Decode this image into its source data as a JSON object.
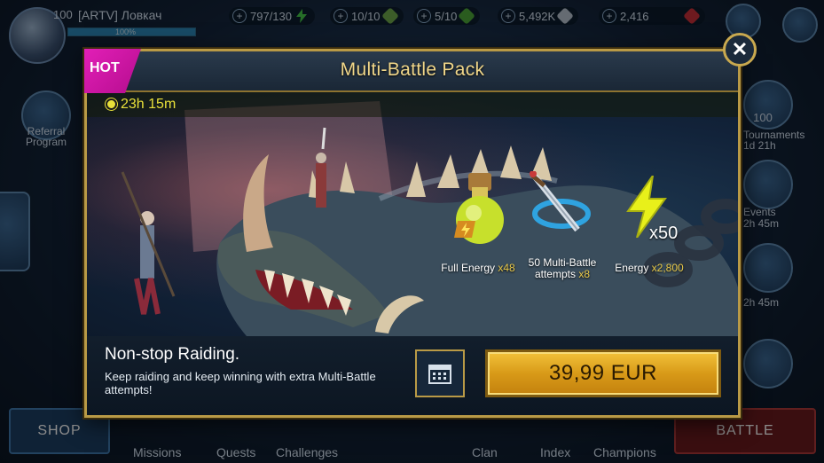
{
  "hud": {
    "player_level": "100",
    "player_name": "[ARTV] Ловкач",
    "xp_percent_text": "100%",
    "resources": [
      {
        "value": "797/130",
        "icon": "energy-icon",
        "color": "#45c94a"
      },
      {
        "value": "10/10",
        "icon": "arena-token-icon",
        "color": "#6ea84b"
      },
      {
        "value": "5/10",
        "icon": "clan-boss-key-icon",
        "color": "#4da83a"
      },
      {
        "value": "5,492K",
        "icon": "silver-icon",
        "color": "#b8c4cf"
      },
      {
        "value": "2,416",
        "icon": "ruby-icon",
        "color": "#c9303a"
      }
    ],
    "left_menu": {
      "referral_label": "Referral Program"
    },
    "right_menu": {
      "tournaments_count": "100",
      "tournaments_label": "Tournaments",
      "tournaments_timer": "1d 21h",
      "events_label": "Events",
      "events_timer": "2h 45m",
      "other_timer": "2h 45m"
    },
    "bottom_nav": {
      "shop": "SHOP",
      "missions": "Missions",
      "quests": "Quests",
      "challenges": "Challenges",
      "clan": "Clan",
      "index": "Index",
      "champions": "Champions",
      "battle": "BATTLE"
    }
  },
  "offer": {
    "badge": "HOT",
    "title": "Multi-Battle Pack",
    "timer": "23h 15m",
    "rewards": [
      {
        "label": "Full Energy",
        "mult": "x48",
        "icon": "energy-potion-icon"
      },
      {
        "label": "50 Multi-Battle attempts",
        "mult": "x8",
        "icon": "multi-battle-sword-icon",
        "badge": "x50"
      },
      {
        "label": "Energy",
        "mult": "x2,800",
        "icon": "energy-bolt-icon"
      }
    ],
    "headline": "Non-stop Raiding.",
    "description": "Keep raiding and keep winning with extra Multi-Battle attempts!",
    "price": "39,99 EUR",
    "close_label": "✕"
  },
  "colors": {
    "gold_border": "#b99a46",
    "hot_badge": "#d418a8",
    "timer_yellow": "#e8e03a",
    "buy_button": "#e0a420"
  }
}
